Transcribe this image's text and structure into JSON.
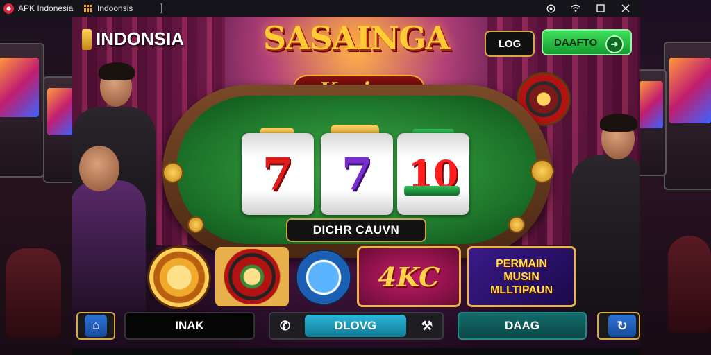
{
  "window": {
    "app_name": "APK Indonesia",
    "tab_title": "Indoonsis",
    "controls": {
      "circle_icon": "circle-dot-icon",
      "wifi_icon": "wifi-icon",
      "maximize_icon": "maximize-icon",
      "close_icon": "close-icon"
    }
  },
  "header": {
    "brand_text": "INDONSIA",
    "logo_title": "SASAINGA",
    "logo_subtitle": "Kasino",
    "login_label": "LOG",
    "register_label": "DAAFTO"
  },
  "table": {
    "reels": [
      "7",
      "7",
      "10"
    ],
    "label": "DICHR CAUVN"
  },
  "games": {
    "tile_4kc": "4KC",
    "tile_multi_lines": [
      "PERMAIN",
      "MUSIN",
      "MLLTIPAUN"
    ]
  },
  "bottom_bar": {
    "inak_label": "INAK",
    "dlovg_label": "DLOVG",
    "daag_label": "DAAG"
  },
  "colors": {
    "accent_gold": "#e9b44a",
    "register_green": "#2bc94a",
    "teal_button": "#2bb7d6",
    "title_bar": "#17151c"
  }
}
